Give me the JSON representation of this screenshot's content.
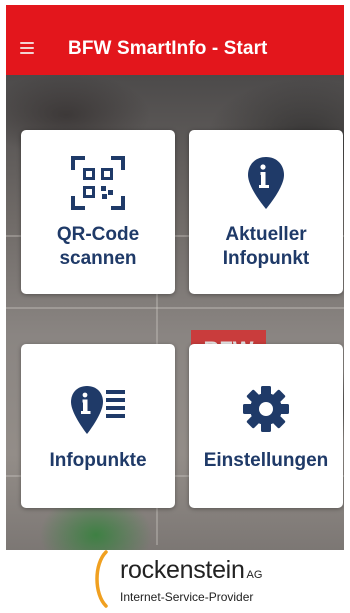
{
  "header": {
    "title": "BFW SmartInfo - Start",
    "menu_icon": "hamburger-menu-icon"
  },
  "tiles": [
    {
      "label_line1": "QR-Code",
      "label_line2": "scannen",
      "icon": "qr-code-icon"
    },
    {
      "label_line1": "Aktueller",
      "label_line2": "Infopunkt",
      "icon": "location-pin-info-icon"
    },
    {
      "label": "Infopunkte",
      "icon": "info-list-icon"
    },
    {
      "label": "Einstellungen",
      "icon": "gear-icon"
    }
  ],
  "background_sign": "BFW",
  "footer": {
    "brand": "rockenstein",
    "brand_suffix": "AG",
    "tagline": "Internet-Service-Provider"
  },
  "colors": {
    "header_red": "#e3161c",
    "tile_text_navy": "#1f3a68",
    "logo_paren_orange": "#f0a020"
  }
}
